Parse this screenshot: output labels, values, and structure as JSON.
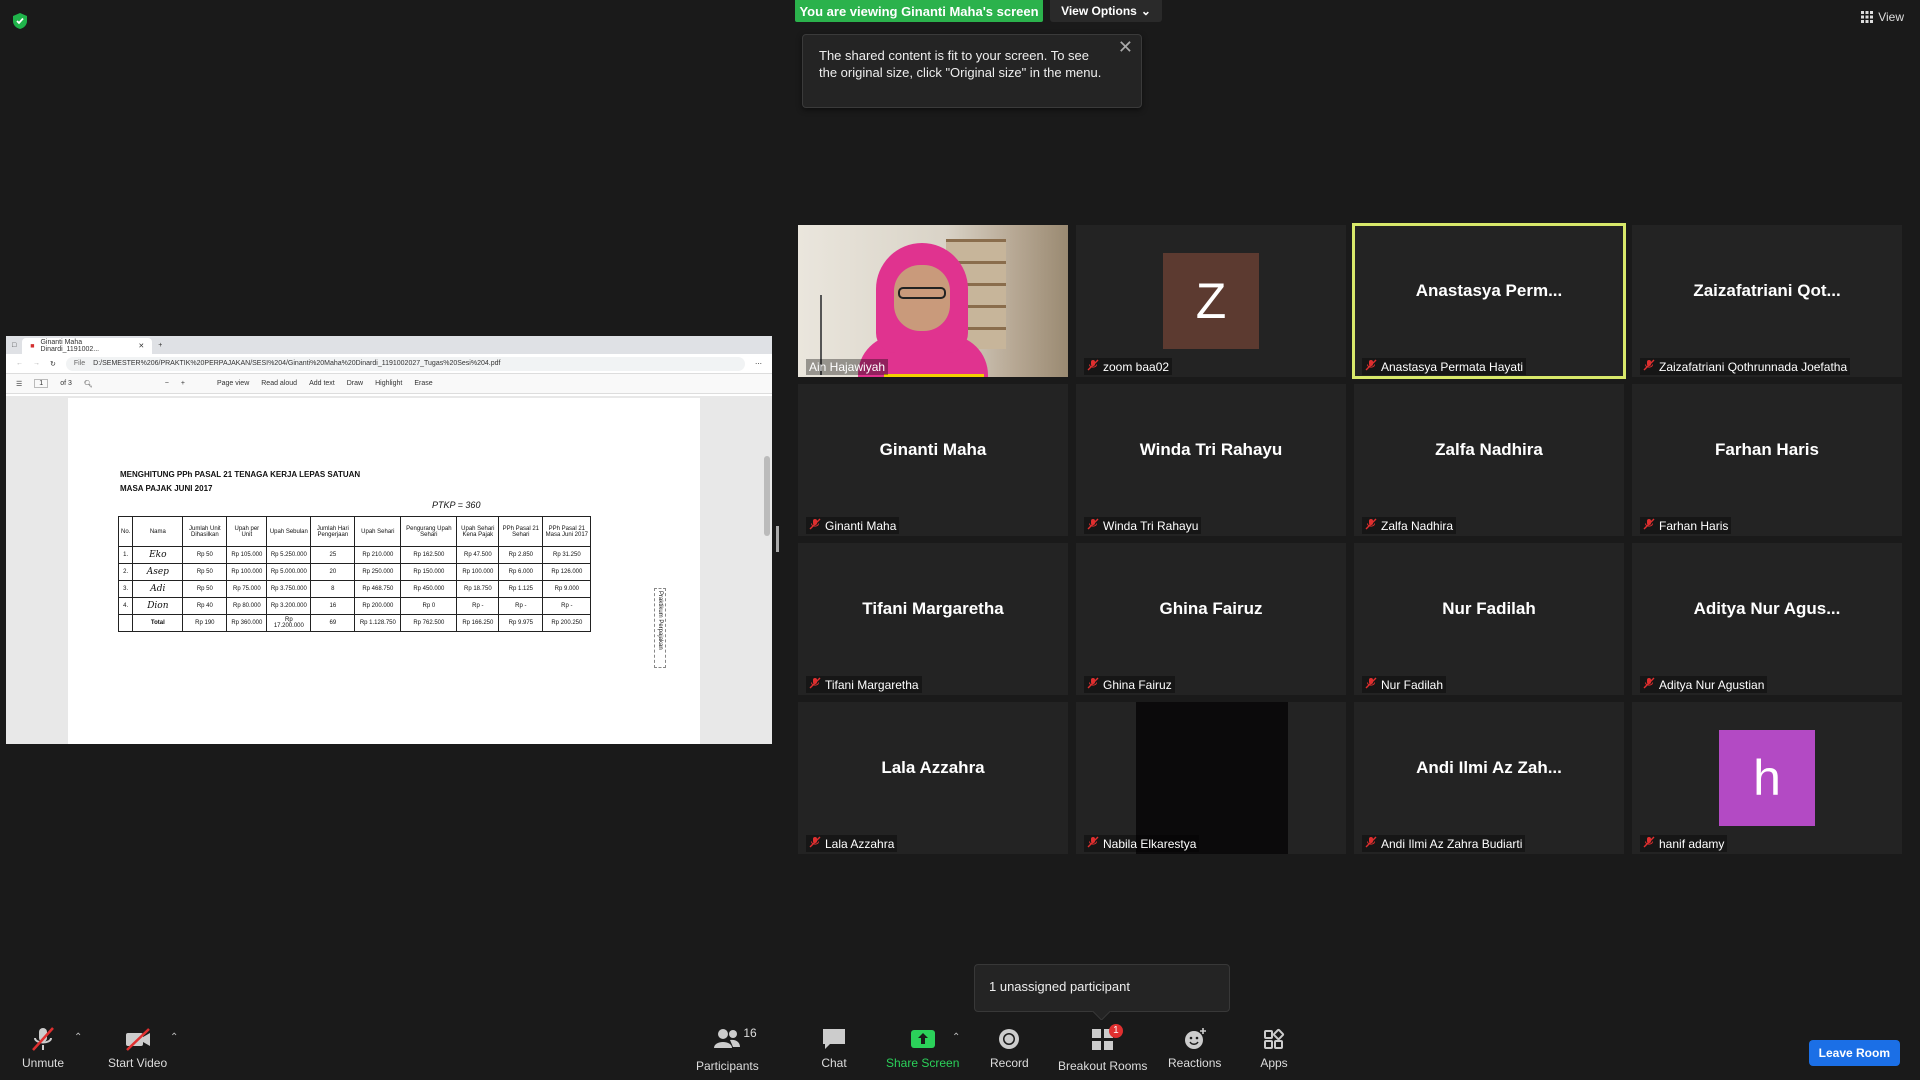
{
  "banner": {
    "viewing": "You are viewing Ginanti Maha's screen",
    "view_options": "View Options"
  },
  "view_button": "View",
  "tooltip": {
    "text": "The shared content is fit to your screen. To see the original size, click \"Original size\" in the menu."
  },
  "shared_screen": {
    "tab_title": "Ginanti Maha Dinardi_1191002...",
    "address": "D:/SEMESTER%206/PRAKTIK%20PERPAJAKAN/SESI%204/Ginanti%20Maha%20Dinardi_1191002027_Tugas%20Sesi%204.pdf",
    "file_label": "File",
    "page_num": "1",
    "page_total": "of 3",
    "toolbar": [
      "Page view",
      "Read aloud",
      "Add text",
      "Draw",
      "Highlight",
      "Erase"
    ],
    "doc_title_1": "MENGHITUNG PPh PASAL 21 TENAGA KERJA LEPAS SATUAN",
    "doc_title_2": "MASA PAJAK JUNI 2017",
    "ptkp": "PTKP = 360",
    "side_label": "Praktikum Perpajakan",
    "table": {
      "headers": [
        "No.",
        "Nama",
        "Jumlah Unit Dihasilkan",
        "Upah per Unit",
        "Upah Sebulan",
        "Jumlah Hari Pengerjaan",
        "Upah Sehari",
        "Pengurang Upah Sehari",
        "Upah Sehari Kena Pajak",
        "PPh Pasal 21 Sehari",
        "PPh Pasal 21 Masa Juni 2017"
      ],
      "rows": [
        [
          "1.",
          "Eko",
          "Rp 50",
          "Rp 105.000",
          "Rp 5.250.000",
          "25",
          "Rp 210.000",
          "Rp 162.500",
          "Rp 47.500",
          "Rp 2.850",
          "Rp 31.250"
        ],
        [
          "2.",
          "Asep",
          "Rp 50",
          "Rp 100.000",
          "Rp 5.000.000",
          "20",
          "Rp 250.000",
          "Rp 150.000",
          "Rp 100.000",
          "Rp 6.000",
          "Rp 126.000"
        ],
        [
          "3.",
          "Adi",
          "Rp 50",
          "Rp 75.000",
          "Rp 3.750.000",
          "8",
          "Rp 468.750",
          "Rp 450.000",
          "Rp 18.750",
          "Rp 1.125",
          "Rp 9.000"
        ],
        [
          "4.",
          "Dion",
          "Rp 40",
          "Rp 80.000",
          "Rp 3.200.000",
          "16",
          "Rp 200.000",
          "Rp 0",
          "Rp -",
          "Rp -",
          "Rp -"
        ]
      ],
      "total": [
        "",
        "Total",
        "Rp 190",
        "Rp 360.000",
        "Rp 17.200.000",
        "69",
        "Rp 1.128.750",
        "Rp 762.500",
        "Rp 166.250",
        "Rp 9.975",
        "Rp 200.250"
      ]
    }
  },
  "participants": [
    {
      "display": "",
      "label": "Ain Hajawiyah",
      "type": "video",
      "muted": false
    },
    {
      "display": "Z",
      "label": "zoom baa02",
      "type": "avatar",
      "avatar_color": "#5c3a30",
      "muted": true
    },
    {
      "display": "Anastasya Perm...",
      "label": "Anastasya Permata Hayati",
      "type": "name",
      "muted": true,
      "active": true
    },
    {
      "display": "Zaizafatriani Qot...",
      "label": "Zaizafatriani Qothrunnada Joefatha",
      "type": "name",
      "muted": true
    },
    {
      "display": "Ginanti Maha",
      "label": "Ginanti Maha",
      "type": "name",
      "muted": true
    },
    {
      "display": "Winda Tri Rahayu",
      "label": "Winda Tri Rahayu",
      "type": "name",
      "muted": true
    },
    {
      "display": "Zalfa Nadhira",
      "label": "Zalfa Nadhira",
      "type": "name",
      "muted": true
    },
    {
      "display": "Farhan Haris",
      "label": "Farhan Haris",
      "type": "name",
      "muted": true
    },
    {
      "display": "Tifani Margaretha",
      "label": "Tifani Margaretha",
      "type": "name",
      "muted": true
    },
    {
      "display": "Ghina Fairuz",
      "label": "Ghina Fairuz",
      "type": "name",
      "muted": true
    },
    {
      "display": "Nur Fadilah",
      "label": "Nur Fadilah",
      "type": "name",
      "muted": true
    },
    {
      "display": "Aditya Nur Agus...",
      "label": "Aditya Nur Agustian",
      "type": "name",
      "muted": true
    },
    {
      "display": "Lala Azzahra",
      "label": "Lala Azzahra",
      "type": "name",
      "muted": true
    },
    {
      "display": "",
      "label": "Nabila Elkarestya",
      "type": "black",
      "muted": true
    },
    {
      "display": "Andi Ilmi Az Zah...",
      "label": "Andi Ilmi Az Zahra Budiarti",
      "type": "name",
      "muted": true
    },
    {
      "display": "h",
      "label": "hanif adamy",
      "type": "avatar",
      "avatar_color": "#b34ac4",
      "muted": true
    }
  ],
  "popover": "1 unassigned participant",
  "toolbar": {
    "unmute": "Unmute",
    "start_video": "Start Video",
    "participants": "Participants",
    "participants_count": "16",
    "chat": "Chat",
    "share_screen": "Share Screen",
    "record": "Record",
    "breakout_rooms": "Breakout Rooms",
    "breakout_badge": "1",
    "reactions": "Reactions",
    "apps": "Apps",
    "leave": "Leave Room"
  },
  "colors": {
    "share_green": "#2bb24c",
    "active_speaker": "#d8e86a",
    "leave_blue": "#1b6fe6",
    "muted_red": "#e02f2f"
  }
}
